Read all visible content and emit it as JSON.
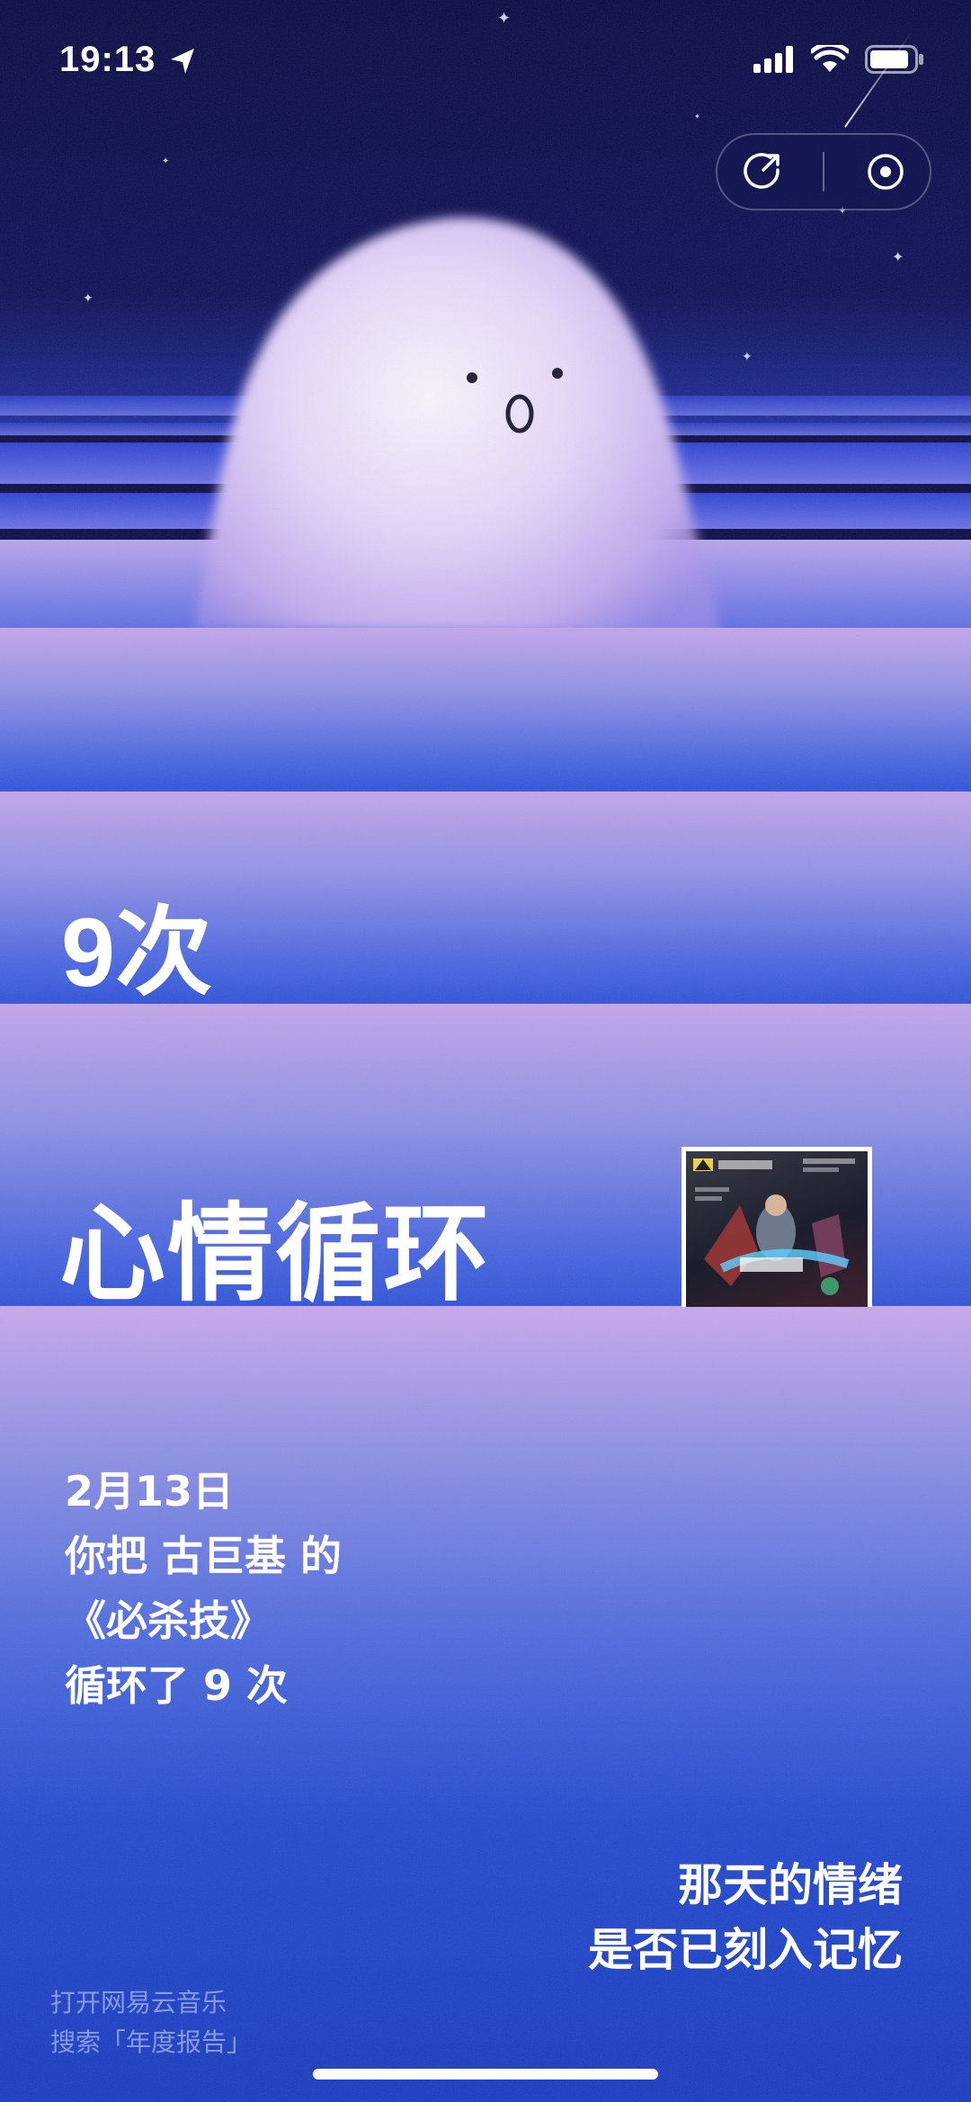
{
  "status_bar": {
    "time": "19:13"
  },
  "report": {
    "count": "9次",
    "title": "心情循环",
    "detail_lines": [
      "2月13日",
      "你把 古巨基 的",
      "《必杀技》",
      "循环了 9 次"
    ],
    "mood_lines": [
      "那天的情绪",
      "是否已刻入记忆"
    ]
  },
  "footer": {
    "lines": [
      "打开网易云音乐",
      "搜索「年度报告」"
    ]
  },
  "icons": {
    "location": "location-arrow-icon",
    "signal": "cellular-signal-icon",
    "wifi": "wifi-icon",
    "battery": "battery-icon",
    "share": "share-icon",
    "close": "close-miniapp-icon"
  },
  "colors": {
    "sky": "#070845",
    "band_top": "#c3a5ec",
    "band_bottom": "#2c50d8",
    "text": "#ffffff"
  }
}
